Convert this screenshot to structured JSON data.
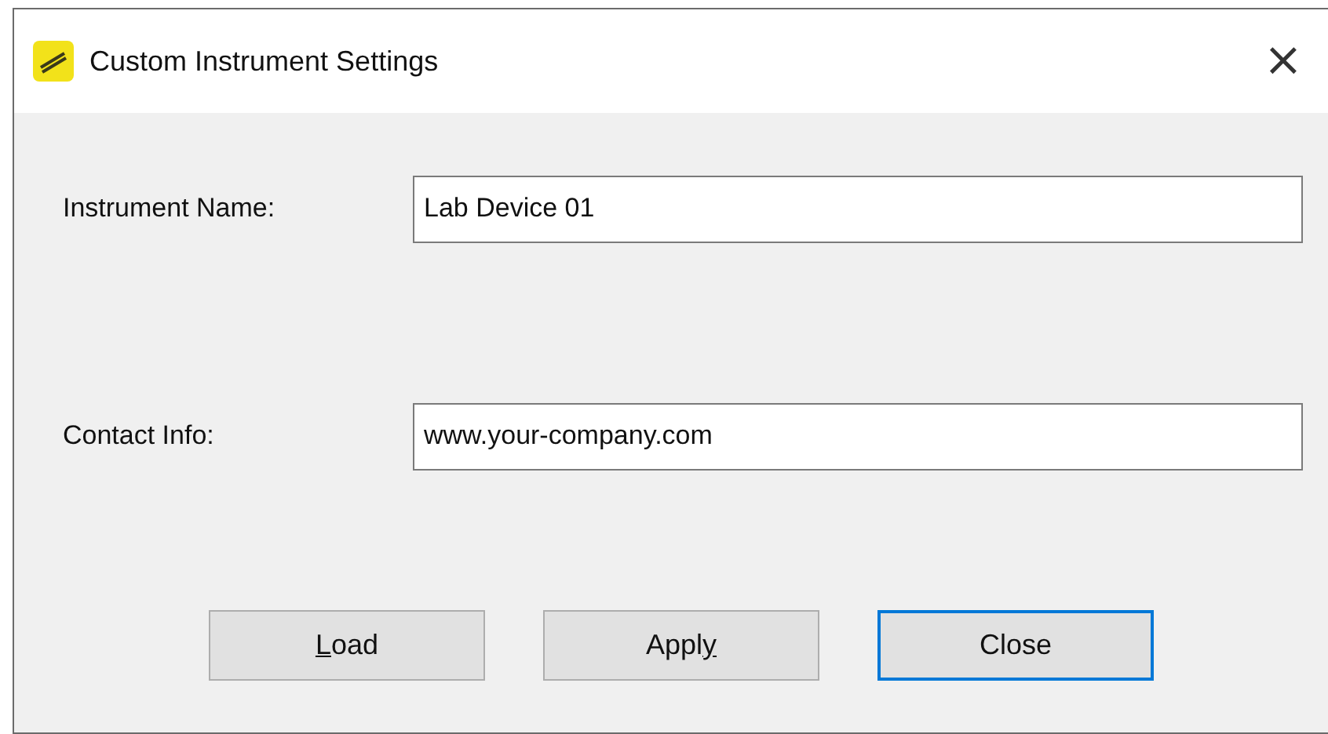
{
  "window": {
    "title": "Custom Instrument Settings",
    "close_glyph": "×"
  },
  "fields": [
    {
      "label": "Instrument Name:",
      "value": "Lab Device 01"
    },
    {
      "label": "Contact Info:",
      "value": "www.your-company.com"
    }
  ],
  "buttons": [
    {
      "label_parts": [
        {
          "text": "L",
          "underlined": true
        },
        {
          "text": "oad",
          "underlined": false
        }
      ],
      "default": false
    },
    {
      "label_parts": [
        {
          "text": "Appl",
          "underlined": false
        },
        {
          "text": "y",
          "underlined": true
        }
      ],
      "default": false
    },
    {
      "label_parts": [
        {
          "text": "Close",
          "underlined": false
        }
      ],
      "default": true
    }
  ]
}
